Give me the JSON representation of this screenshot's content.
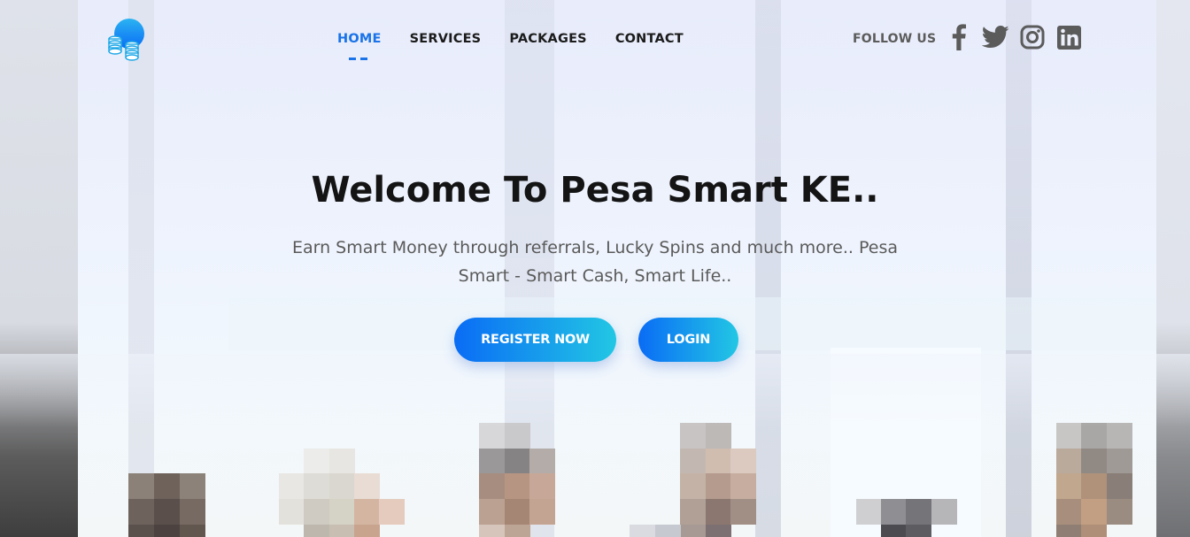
{
  "logo": {
    "icon": "coins-stack-icon",
    "color_top": "#2bb3f2",
    "color_bottom": "#0a6cf5"
  },
  "nav": {
    "items": [
      {
        "label": "HOME",
        "active": true
      },
      {
        "label": "SERVICES",
        "active": false
      },
      {
        "label": "PACKAGES",
        "active": false
      },
      {
        "label": "CONTACT",
        "active": false
      }
    ],
    "active_color": "#1a73e8"
  },
  "social": {
    "label": "FOLLOW US",
    "icons": [
      "facebook-icon",
      "twitter-icon",
      "instagram-icon",
      "linkedin-icon"
    ],
    "icon_color": "#5b5b5b"
  },
  "hero": {
    "title": "Welcome To Pesa Smart KE..",
    "subtitle_line1": "Earn Smart Money through referrals, Lucky Spins and much more.. Pesa",
    "subtitle_line2": "Smart - Smart Cash, Smart Life..",
    "register_label": "REGISTER NOW",
    "login_label": "LOGIN",
    "button_gradient": [
      "#0a6cf5",
      "#22c7e4"
    ]
  }
}
